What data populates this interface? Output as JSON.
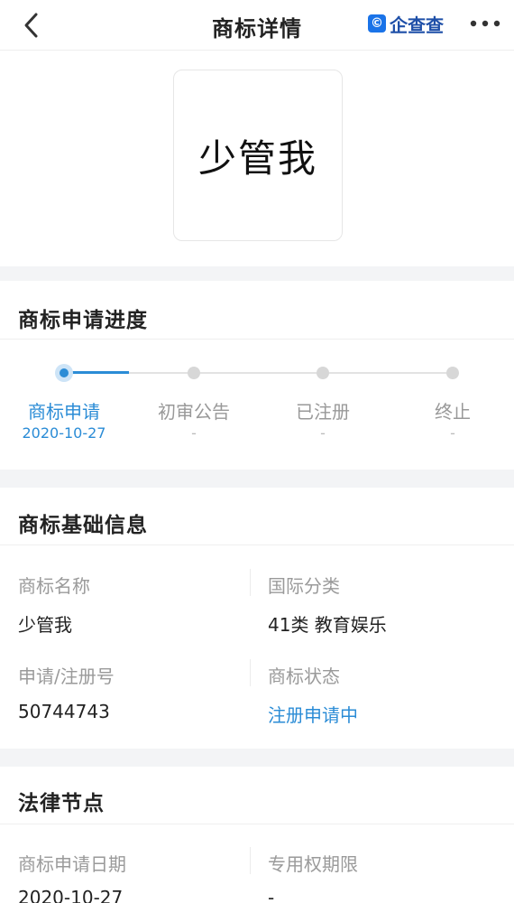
{
  "header": {
    "title": "商标详情",
    "brand": "企查查",
    "brand_logo_char": "©",
    "back_icon": "chevron-left-icon",
    "more_icon": "more-dots-icon"
  },
  "trademark_logo": {
    "text": "少管我"
  },
  "progress": {
    "title": "商标申请进度",
    "steps": [
      {
        "label": "商标申请",
        "date": "2020-10-27",
        "active": true
      },
      {
        "label": "初审公告",
        "date": "-",
        "active": false
      },
      {
        "label": "已注册",
        "date": "-",
        "active": false
      },
      {
        "label": "终止",
        "date": "-",
        "active": false
      }
    ]
  },
  "basic_info": {
    "title": "商标基础信息",
    "name_label": "商标名称",
    "name_value": "少管我",
    "class_label": "国际分类",
    "class_value": "41类 教育娱乐",
    "reg_no_label": "申请/注册号",
    "reg_no_value": "50744743",
    "status_label": "商标状态",
    "status_value": "注册申请中"
  },
  "legal": {
    "title": "法律节点",
    "apply_date_label": "商标申请日期",
    "apply_date_value": "2020-10-27",
    "term_label": "专用权期限",
    "term_value": "-"
  },
  "colors": {
    "accent": "#2b8cd6",
    "brand": "#1e4fa8",
    "gap": "#f3f4f6"
  }
}
